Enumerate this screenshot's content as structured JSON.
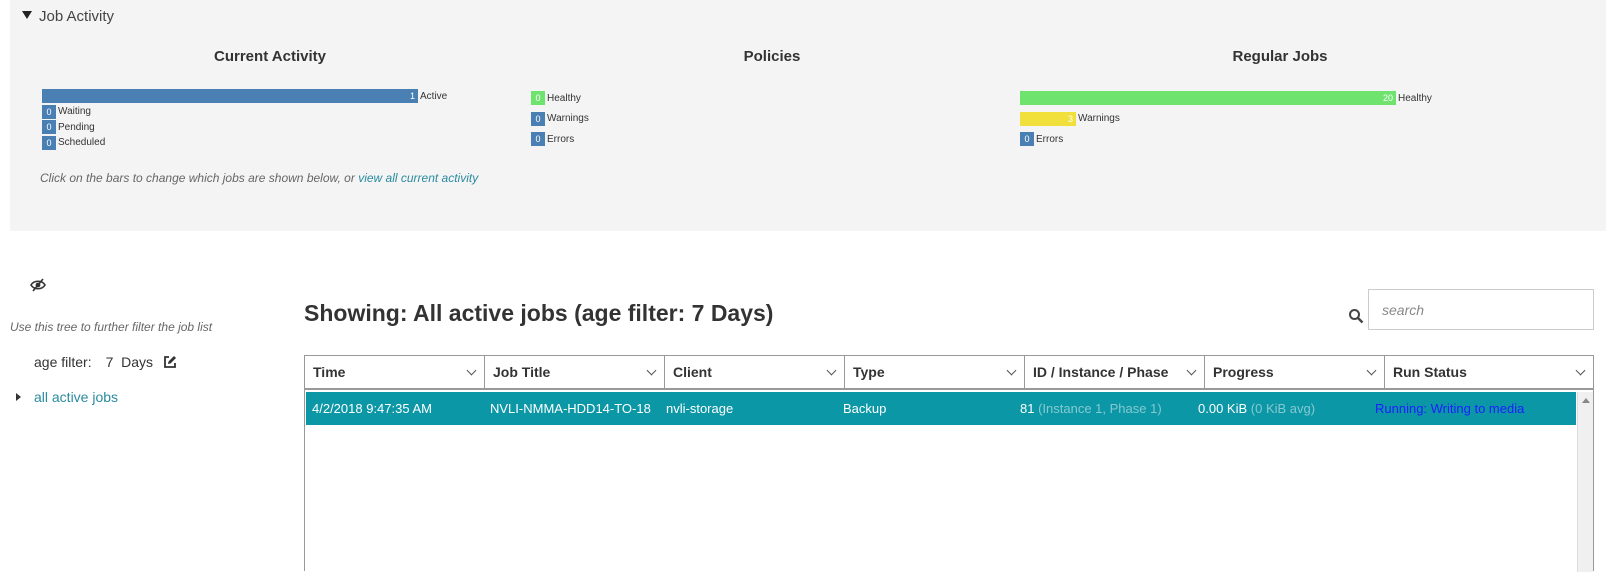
{
  "panel": {
    "title": "Job Activity",
    "hint_text": "Click on the bars to change which jobs are shown below, or ",
    "hint_link": "view all current activity"
  },
  "current_activity": {
    "title": "Current Activity",
    "rows": [
      {
        "count": "1",
        "label": "Active",
        "fraction": 1.0,
        "color": "#4a7fb3"
      },
      {
        "count": "0",
        "label": "Waiting",
        "fraction": 0,
        "color": "#4a7fb3"
      },
      {
        "count": "0",
        "label": "Pending",
        "fraction": 0,
        "color": "#4a7fb3"
      },
      {
        "count": "0",
        "label": "Scheduled",
        "fraction": 0,
        "color": "#4a7fb3"
      }
    ]
  },
  "policies": {
    "title": "Policies",
    "rows": [
      {
        "count": "0",
        "label": "Healthy",
        "fraction": 0,
        "color": "#6ee46e"
      },
      {
        "count": "0",
        "label": "Warnings",
        "fraction": 0,
        "color": "#4a7fb3"
      },
      {
        "count": "0",
        "label": "Errors",
        "fraction": 0,
        "color": "#4a7fb3"
      }
    ]
  },
  "regular_jobs": {
    "title": "Regular Jobs",
    "rows": [
      {
        "count": "20",
        "label": "Healthy",
        "fraction": 1.0,
        "color": "#6ee46e"
      },
      {
        "count": "3",
        "label": "Warnings",
        "fraction": 0.15,
        "color": "#f1df3c"
      },
      {
        "count": "0",
        "label": "Errors",
        "fraction": 0,
        "color": "#4a7fb3"
      }
    ]
  },
  "tree": {
    "hint": "Use this tree to further filter the job list",
    "age_filter_label": "age filter:",
    "age_filter_value": "7  Days",
    "node_label": "all active jobs"
  },
  "main": {
    "heading": "Showing: All active jobs (age filter: 7 Days)",
    "search_placeholder": "search"
  },
  "table": {
    "columns": [
      "Time",
      "Job Title",
      "Client",
      "Type",
      "ID / Instance / Phase",
      "Progress",
      "Run Status"
    ],
    "rows": [
      {
        "time": "4/2/2018 9:47:35 AM",
        "job_title": "NVLI-NMMA-HDD14-TO-18",
        "client": "nvli-storage",
        "type": "Backup",
        "id": "81",
        "instance_phase": "(Instance 1, Phase 1)",
        "progress": "0.00 KiB",
        "progress_avg": "(0 KiB avg)",
        "run_status": "Running: Writing to media"
      }
    ]
  },
  "icons": {
    "panel_toggle": "triangle-down-icon",
    "visibility": "eye-slash-icon",
    "edit": "edit-icon",
    "tree_caret": "caret-right-icon",
    "search": "search-icon",
    "column_sort": "chevron-down-icon"
  }
}
